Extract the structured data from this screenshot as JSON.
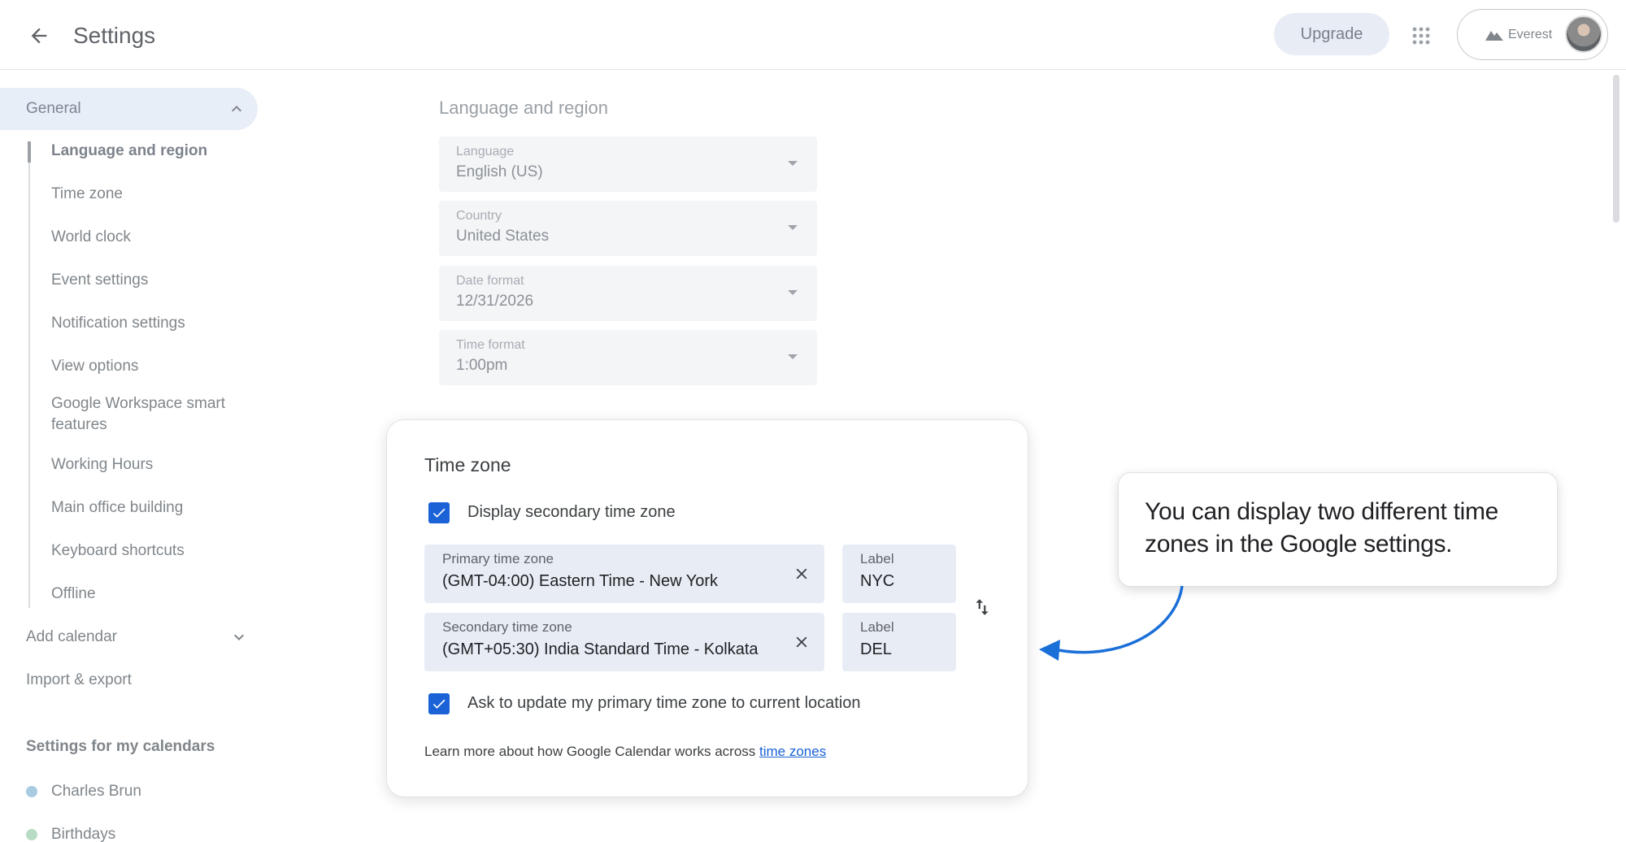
{
  "header": {
    "title": "Settings",
    "upgrade_label": "Upgrade",
    "account_name": "Everest",
    "icons": {
      "back": "arrow-left-icon",
      "apps": "apps-grid-icon",
      "account": "mountain-logo-icon"
    }
  },
  "sidebar": {
    "general_label": "General",
    "general_items": [
      {
        "label": "Language and region"
      },
      {
        "label": "Time zone"
      },
      {
        "label": "World clock"
      },
      {
        "label": "Event settings"
      },
      {
        "label": "Notification settings"
      },
      {
        "label": "View options"
      },
      {
        "label": "Google Workspace smart features"
      },
      {
        "label": "Working Hours"
      },
      {
        "label": "Main office building"
      },
      {
        "label": "Keyboard shortcuts"
      },
      {
        "label": "Offline"
      }
    ],
    "add_calendar_label": "Add calendar",
    "import_export_label": "Import & export",
    "my_calendars_title": "Settings for my calendars",
    "calendars": [
      {
        "name": "Charles Brun",
        "color": "#a8cbe0"
      },
      {
        "name": "Birthdays",
        "color": "#b7dcc3"
      }
    ]
  },
  "language_region": {
    "heading": "Language and region",
    "fields": [
      {
        "label": "Language",
        "value": "English (US)"
      },
      {
        "label": "Country",
        "value": "United States"
      },
      {
        "label": "Date format",
        "value": "12/31/2026"
      },
      {
        "label": "Time format",
        "value": "1:00pm"
      }
    ]
  },
  "time_zone": {
    "title": "Time zone",
    "display_secondary_label": "Display secondary time zone",
    "display_secondary_checked": true,
    "primary": {
      "label": "Primary time zone",
      "value": "(GMT-04:00) Eastern Time - New York"
    },
    "primary_short": {
      "label": "Label",
      "value": "NYC"
    },
    "secondary": {
      "label": "Secondary time zone",
      "value": "(GMT+05:30) India Standard Time - Kolkata"
    },
    "secondary_short": {
      "label": "Label",
      "value": "DEL"
    },
    "ask_update_label": "Ask to update my primary time zone to current location",
    "ask_update_checked": true,
    "learn_more_text": "Learn more about how Google Calendar works across ",
    "learn_more_link": "time zones"
  },
  "callout": {
    "text": "You can display two different time zones in the Google settings."
  },
  "colors": {
    "accent": "#1a62d6",
    "callout_arrow": "#1a6fd9",
    "nav_active_bg": "#e8eef8",
    "field_bg": "#e8edf5"
  }
}
